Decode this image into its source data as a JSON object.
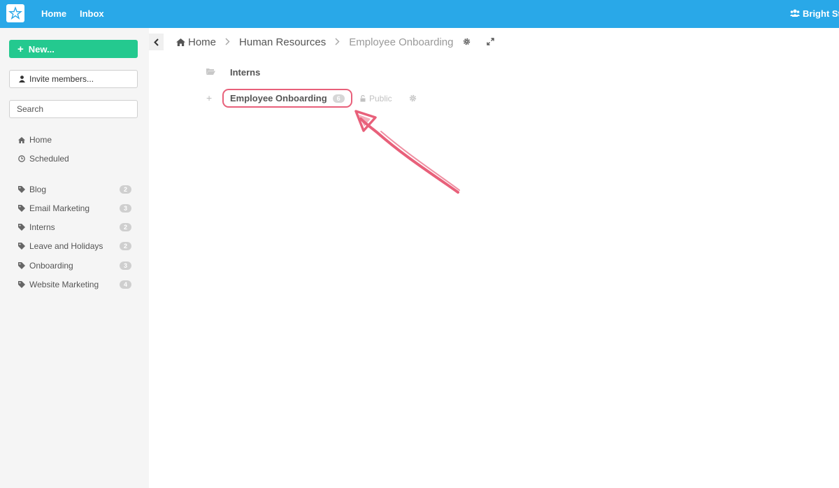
{
  "topbar": {
    "nav": [
      {
        "label": "Home"
      },
      {
        "label": "Inbox"
      }
    ],
    "account_label": "Bright Sta"
  },
  "sidebar": {
    "new_button": "New...",
    "invite_button": "Invite members...",
    "search_placeholder": "Search",
    "nav": [
      {
        "label": "Home",
        "icon": "home-icon"
      },
      {
        "label": "Scheduled",
        "icon": "clock-icon"
      }
    ],
    "tags": [
      {
        "label": "Blog",
        "count": "2"
      },
      {
        "label": "Email Marketing",
        "count": "3"
      },
      {
        "label": "Interns",
        "count": "2"
      },
      {
        "label": "Leave and Holidays",
        "count": "2"
      },
      {
        "label": "Onboarding",
        "count": "3"
      },
      {
        "label": "Website Marketing",
        "count": "4"
      }
    ]
  },
  "breadcrumb": {
    "home": "Home",
    "parent": "Human Resources",
    "current": "Employee Onboarding"
  },
  "content": {
    "folder": "Interns",
    "project": {
      "name": "Employee Onboarding",
      "count": "6",
      "visibility": "Public"
    }
  },
  "colors": {
    "topbar": "#29a8e8",
    "new_button": "#24c98f",
    "annotation": "#e8607a"
  }
}
